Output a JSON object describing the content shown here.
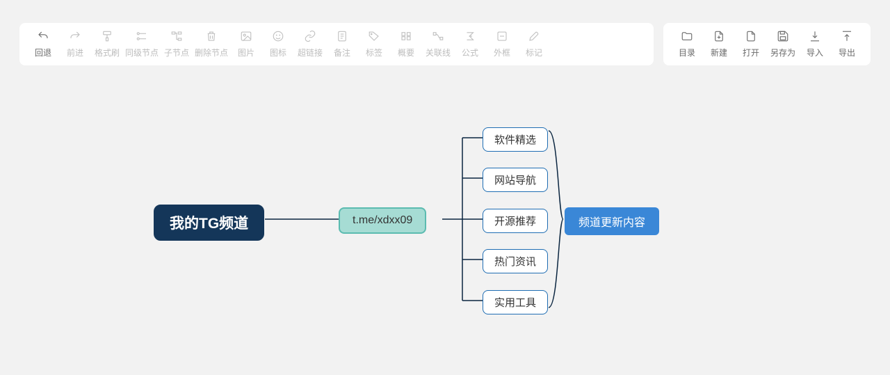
{
  "toolbar": {
    "main": [
      {
        "label": "回退",
        "icon": "undo-icon",
        "enabled": true
      },
      {
        "label": "前进",
        "icon": "redo-icon",
        "enabled": false
      },
      {
        "label": "格式刷",
        "icon": "format-painter-icon",
        "enabled": false
      },
      {
        "label": "同级节点",
        "icon": "sibling-node-icon",
        "enabled": false
      },
      {
        "label": "子节点",
        "icon": "child-node-icon",
        "enabled": false
      },
      {
        "label": "删除节点",
        "icon": "delete-node-icon",
        "enabled": false
      },
      {
        "label": "图片",
        "icon": "image-icon",
        "enabled": false
      },
      {
        "label": "图标",
        "icon": "smiley-icon",
        "enabled": false
      },
      {
        "label": "超链接",
        "icon": "link-icon",
        "enabled": false
      },
      {
        "label": "备注",
        "icon": "note-icon",
        "enabled": false
      },
      {
        "label": "标签",
        "icon": "tag-icon",
        "enabled": false
      },
      {
        "label": "概要",
        "icon": "summary-icon",
        "enabled": false
      },
      {
        "label": "关联线",
        "icon": "relation-line-icon",
        "enabled": false
      },
      {
        "label": "公式",
        "icon": "formula-icon",
        "enabled": false
      },
      {
        "label": "外框",
        "icon": "frame-icon",
        "enabled": false
      },
      {
        "label": "标记",
        "icon": "mark-icon",
        "enabled": false
      }
    ],
    "file": [
      {
        "label": "目录",
        "icon": "folder-icon"
      },
      {
        "label": "新建",
        "icon": "new-file-icon"
      },
      {
        "label": "打开",
        "icon": "open-file-icon"
      },
      {
        "label": "另存为",
        "icon": "save-as-icon"
      },
      {
        "label": "导入",
        "icon": "import-icon"
      },
      {
        "label": "导出",
        "icon": "export-icon"
      }
    ]
  },
  "mindmap": {
    "root": {
      "text": "我的TG频道"
    },
    "level1": {
      "text": "t.me/xdxx09"
    },
    "level2": [
      {
        "text": "软件精选"
      },
      {
        "text": "网站导航"
      },
      {
        "text": "开源推荐"
      },
      {
        "text": "热门资讯"
      },
      {
        "text": "实用工具"
      }
    ],
    "level3": {
      "text": "频道更新内容"
    }
  }
}
